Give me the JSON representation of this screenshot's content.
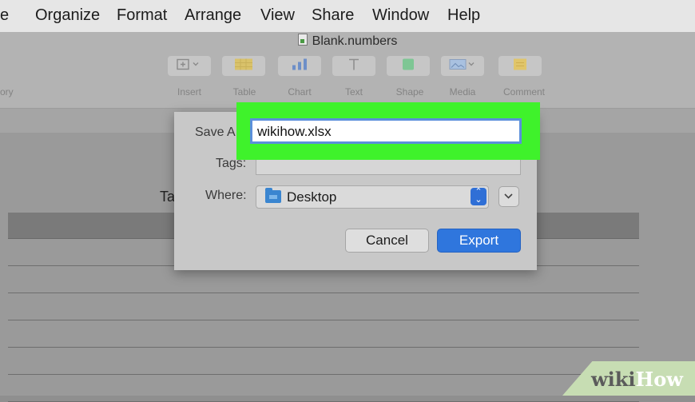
{
  "menu": [
    "e",
    "Organize",
    "Format",
    "Arrange",
    "View",
    "Share",
    "Window",
    "Help"
  ],
  "document": {
    "title": "Blank.numbers"
  },
  "toolbar": {
    "left_label": "ory",
    "items": [
      {
        "label": "Insert",
        "icon": "insert-icon"
      },
      {
        "label": "Table",
        "icon": "table-icon"
      },
      {
        "label": "Chart",
        "icon": "chart-icon"
      },
      {
        "label": "Text",
        "icon": "text-icon"
      },
      {
        "label": "Shape",
        "icon": "shape-icon"
      },
      {
        "label": "Media",
        "icon": "media-icon"
      },
      {
        "label": "Comment",
        "icon": "comment-icon"
      }
    ]
  },
  "sheet": {
    "title_fragment": "Ta"
  },
  "dialog": {
    "save_as_label": "Save A",
    "filename_value": "wikihow.xlsx",
    "tags_label": "Tags:",
    "tags_value": "",
    "where_label": "Where:",
    "where_value": "Desktop",
    "cancel_label": "Cancel",
    "export_label": "Export"
  },
  "watermark": {
    "part1": "wiki",
    "part2": "How"
  },
  "colors": {
    "highlight": "#3ff22b",
    "accent": "#2f76dd",
    "folder": "#3a85d0"
  }
}
